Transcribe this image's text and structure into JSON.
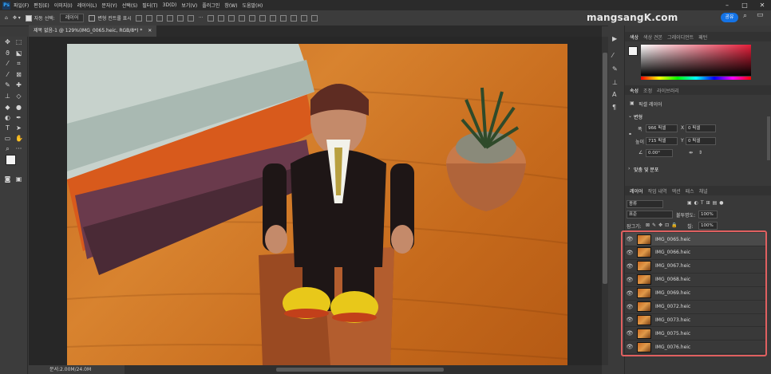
{
  "menu": {
    "app_icon": "Ps",
    "items": [
      "파일(F)",
      "편집(E)",
      "이미지(I)",
      "레이어(L)",
      "문자(Y)",
      "선택(S)",
      "필터(T)",
      "3D(D)",
      "보기(V)",
      "플러그인",
      "창(W)",
      "도움말(H)"
    ]
  },
  "options": {
    "auto_select_label": "자동 선택:",
    "auto_select_value": "레이어",
    "transform_label": "변형 컨트롤 표시"
  },
  "watermark": "mangsangK.com",
  "share_label": "공유",
  "document": {
    "tab_title": "제목 없음-1 @ 129%(IMG_0065.heic, RGB/8*) *",
    "status": "문서:2.00M/24.0M"
  },
  "color_panel": {
    "tabs": [
      "색상",
      "색상 견본",
      "그레이디언트",
      "패턴"
    ]
  },
  "properties_panel": {
    "tabs": [
      "속성",
      "조정",
      "라이브러리"
    ],
    "type_label": "픽셀 레이어",
    "transform_header": "변형",
    "w_label": "폭",
    "w_value": "966 픽셀",
    "x_label": "X",
    "x_value": "0 픽셀",
    "h_label": "높이",
    "h_value": "715 픽셀",
    "y_label": "Y",
    "y_value": "0 픽셀",
    "angle_value": "0.00°",
    "align_header": "맞춤 및 분포"
  },
  "layers_panel": {
    "tabs": [
      "레이어",
      "작업 내역",
      "액션",
      "패스",
      "채널"
    ],
    "filter_value": "종류",
    "blend_mode": "표준",
    "opacity_label": "불투명도:",
    "opacity_value": "100%",
    "lock_label": "잠그기:",
    "fill_label": "칠:",
    "fill_value": "100%",
    "layers": [
      {
        "name": "IMG_0065.heic",
        "selected": true
      },
      {
        "name": "IMG_0066.heic",
        "selected": false
      },
      {
        "name": "IMG_0067.heic",
        "selected": false
      },
      {
        "name": "IMG_0068.heic",
        "selected": false
      },
      {
        "name": "IMG_0069.heic",
        "selected": false
      },
      {
        "name": "IMG_0072.heic",
        "selected": false
      },
      {
        "name": "IMG_0073.heic",
        "selected": false
      },
      {
        "name": "IMG_0075.heic",
        "selected": false
      },
      {
        "name": "IMG_0076.heic",
        "selected": false
      }
    ]
  },
  "colors": {
    "accent": "#1473e6",
    "highlight_border": "#e06060"
  }
}
